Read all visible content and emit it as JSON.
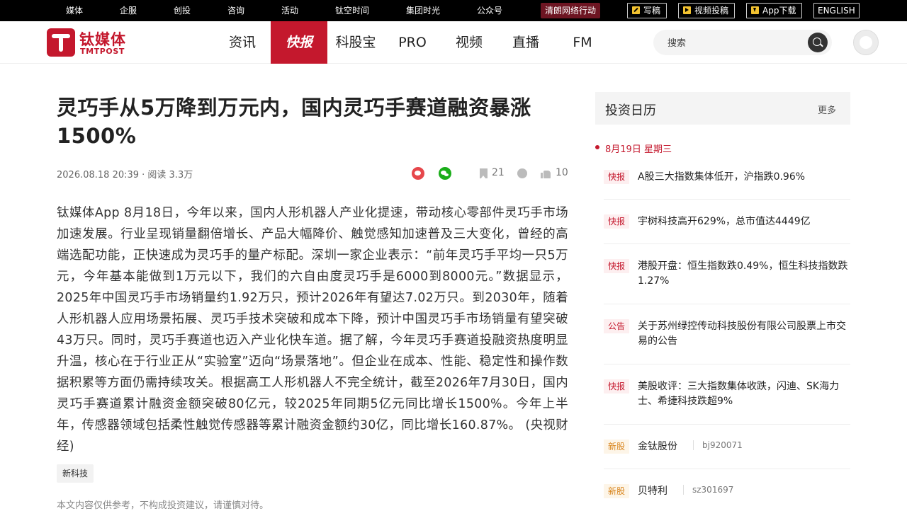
{
  "topbar": {
    "links": [
      "媒体",
      "企服",
      "创投",
      "咨询",
      "活动",
      "钛空时间",
      "集团时光",
      "公众号"
    ],
    "highlight": "清朗网络行动",
    "buttons": [
      "写稿",
      "视频投稿",
      "App下载",
      "ENGLISH"
    ]
  },
  "header": {
    "logo_cn": "钛媒体",
    "logo_en": "TMTPOST",
    "nav": [
      "资讯",
      "快报",
      "科股宝",
      "PRO",
      "视频",
      "直播",
      "FM"
    ],
    "active_nav": "快报",
    "search_placeholder": "搜索"
  },
  "article": {
    "title": "灵巧手从5万降到万元内，国内灵巧手赛道融资暴涨1500%",
    "meta": "2026.08.18 20:39 · 阅读 3.3万",
    "bookmark_count": "21",
    "like_count": "10",
    "body": "钛媒体App 8月18日，今年以来，国内人形机器人产业化提速，带动核心零部件灵巧手市场加速发展。行业呈现销量翻倍增长、产品大幅降价、触觉感知加速普及三大变化，曾经的高端选配功能，正快速成为灵巧手的量产标配。深圳一家企业表示：“前年灵巧手平均一只5万元，今年基本能做到1万元以下，我们的六自由度灵巧手是6000到8000元。”数据显示，2025年中国灵巧手市场销量约1.92万只，预计2026年有望达7.02万只。到2030年，随着人形机器人应用场景拓展、灵巧手技术突破和成本下降，预计中国灵巧手市场销量有望突破43万只。同时，灵巧手赛道也迈入产业化快车道。据了解，今年灵巧手赛道投融资热度明显升温，核心在于行业正从“实验室”迈向“场景落地”。但企业在成本、性能、稳定性和操作数据积累等方面仍需持续攻关。根据高工人形机器人不完全统计，截至2026年7月30日，国内灵巧手赛道累计融资金额突破80亿元，较2025年同期5亿元同比增长1500%。今年上半年，传感器领域包括柔性触觉传感器等累计融资金额约30亿，同比增长160.87%。 (央视财经)",
    "tag": "新科技",
    "disclaimer": "本文内容仅供参考，不构成投资建议，请谨慎对待。"
  },
  "sidebar": {
    "title": "投资日历",
    "more": "更多",
    "date": "8月19日  星期三",
    "items": [
      {
        "badge": "快报",
        "text": "A股三大指数集体低开，沪指跌0.96%"
      },
      {
        "badge": "快报",
        "text": "宇树科技高开629%，总市值达4449亿"
      },
      {
        "badge": "快报",
        "text": "港股开盘：恒生指数跌0.49%，恒生科技指数跌1.27%"
      },
      {
        "badge": "公告",
        "text": "关于苏州绿控传动科技股份有限公司股票上市交易的公告"
      },
      {
        "badge": "快报",
        "text": "美股收评：三大指数集体收跌，闪迪、SK海力士、希捷科技跌超9%"
      },
      {
        "badge": "新股",
        "text": "金钛股份",
        "code": "bj920071"
      },
      {
        "badge": "新股",
        "text": "贝特利",
        "code": "sz301697"
      }
    ]
  }
}
